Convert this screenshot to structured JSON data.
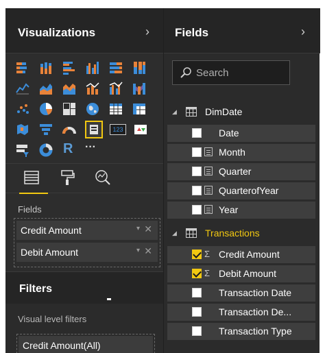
{
  "colors": {
    "accent": "#f2c811",
    "pane_bg": "#2d2d2d",
    "header_bg": "#252525",
    "row_bg": "#3e3e3e"
  },
  "visualizations": {
    "title": "Visualizations",
    "chevron": "›",
    "icons": [
      "stacked-bar-chart-icon",
      "stacked-column-chart-icon",
      "clustered-bar-chart-icon",
      "clustered-column-chart-icon",
      "100-percent-stacked-bar-icon",
      "100-percent-stacked-column-icon",
      "line-chart-icon",
      "area-chart-icon",
      "stacked-area-chart-icon",
      "line-and-stacked-column-icon",
      "line-and-clustered-column-icon",
      "ribbon-chart-icon",
      "scatter-chart-icon",
      "pie-chart-icon",
      "treemap-icon",
      "map-icon",
      "table-icon",
      "matrix-icon",
      "filled-map-icon",
      "funnel-icon",
      "gauge-icon",
      "card-icon",
      "multi-row-card-icon",
      "kpi-icon",
      "slicer-icon",
      "donut-chart-icon",
      "r-script-visual-icon",
      "more-visuals-icon"
    ],
    "icon_texts": {
      "card": "123",
      "r": "R",
      "more": "···"
    },
    "fields_label": "Fields",
    "wells": [
      {
        "label": "Credit Amount"
      },
      {
        "label": "Debit Amount"
      }
    ],
    "well_dropdown": "▾",
    "well_close": "✕"
  },
  "filters": {
    "title": "Filters",
    "visual_level_label": "Visual level filters",
    "items": [
      {
        "label": "Credit Amount(All)"
      }
    ]
  },
  "fields": {
    "title": "Fields",
    "chevron": "›",
    "search_placeholder": "Search",
    "tables": [
      {
        "name": "DimDate",
        "fields": [
          {
            "name": "Date",
            "checked": false,
            "type": "none"
          },
          {
            "name": "Month",
            "checked": false,
            "type": "hierarchy"
          },
          {
            "name": "Quarter",
            "checked": false,
            "type": "hierarchy"
          },
          {
            "name": "QuarterofYear",
            "checked": false,
            "type": "hierarchy"
          },
          {
            "name": "Year",
            "checked": false,
            "type": "hierarchy"
          }
        ]
      },
      {
        "name": "Transactions",
        "fields": [
          {
            "name": "Credit Amount",
            "checked": true,
            "type": "sigma"
          },
          {
            "name": "Debit Amount",
            "checked": true,
            "type": "sigma"
          },
          {
            "name": "Transaction Date",
            "checked": false,
            "type": "none"
          },
          {
            "name": "Transaction De...",
            "checked": false,
            "type": "none"
          },
          {
            "name": "Transaction Type",
            "checked": false,
            "type": "none"
          }
        ]
      }
    ],
    "sigma_glyph": "Σ",
    "collapse_glyph": "◢"
  }
}
